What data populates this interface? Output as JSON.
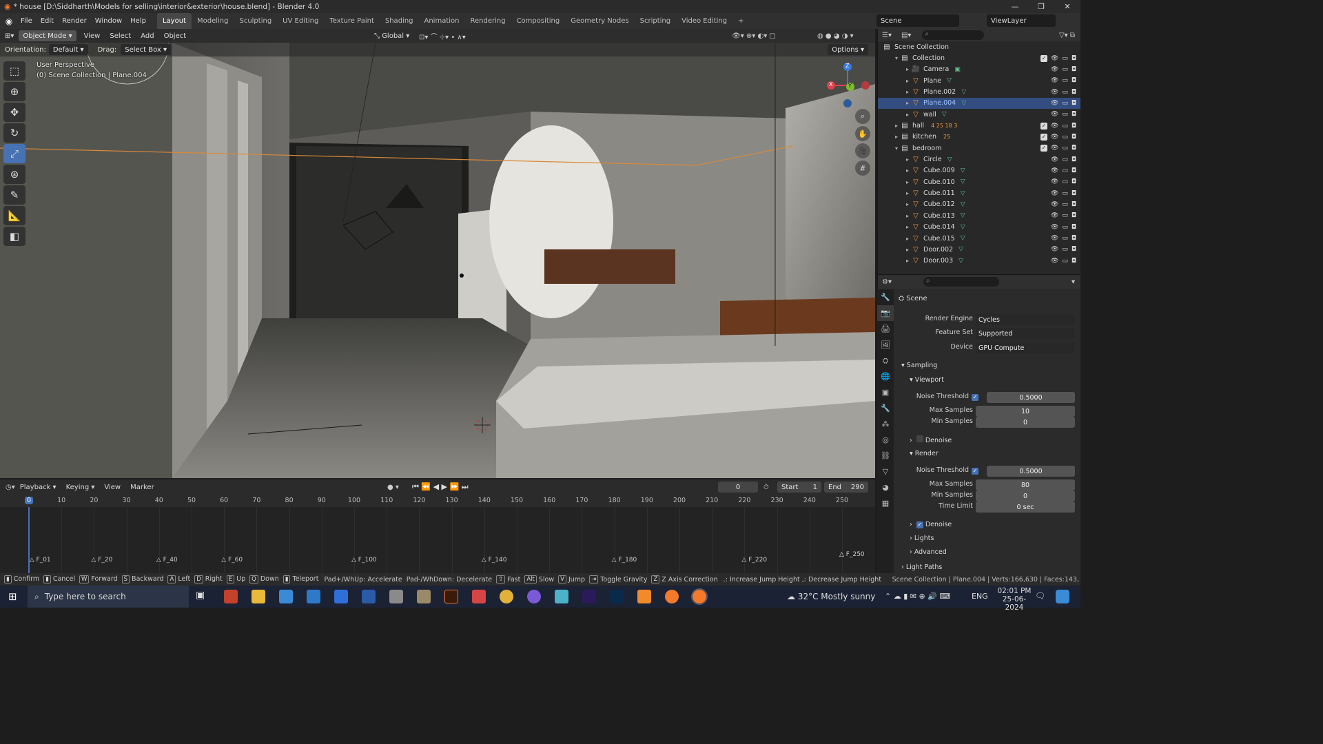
{
  "window": {
    "title": "* house [D:\\Siddharth\\Models for selling\\interior&exterior\\house.blend] - Blender 4.0"
  },
  "menu": [
    "File",
    "Edit",
    "Render",
    "Window",
    "Help"
  ],
  "workspaces": [
    "Layout",
    "Modeling",
    "Sculpting",
    "UV Editing",
    "Texture Paint",
    "Shading",
    "Animation",
    "Rendering",
    "Compositing",
    "Geometry Nodes",
    "Scripting",
    "Video Editing"
  ],
  "scene": {
    "name": "Scene",
    "view_layer": "ViewLayer"
  },
  "viewport": {
    "mode": "Object Mode",
    "menus": [
      "View",
      "Select",
      "Add",
      "Object"
    ],
    "transform_orientation": "Global",
    "orientation_label": "Orientation:",
    "orientation_value": "Default",
    "drag_label": "Drag:",
    "drag_value": "Select Box",
    "options_label": "Options",
    "perspective": "User Perspective",
    "collection_info": "(0) Scene Collection | Plane.004",
    "axis_x": "X",
    "axis_y": "Y",
    "axis_z": "Z"
  },
  "outliner": {
    "root": "Scene Collection",
    "rows": [
      {
        "name": "Collection",
        "type": "collection",
        "level": 0
      },
      {
        "name": "Camera",
        "type": "camera",
        "level": 1
      },
      {
        "name": "Plane",
        "type": "mesh",
        "level": 1
      },
      {
        "name": "Plane.002",
        "type": "mesh",
        "level": 1
      },
      {
        "name": "Plane.004",
        "type": "mesh",
        "level": 1,
        "selected": true
      },
      {
        "name": "wall",
        "type": "mesh",
        "level": 1
      },
      {
        "name": "hall",
        "type": "collection",
        "level": 0,
        "badges": "4 25 18 3"
      },
      {
        "name": "kitchen",
        "type": "collection",
        "level": 0,
        "badges": "25"
      },
      {
        "name": "bedroom",
        "type": "collection",
        "level": 0
      },
      {
        "name": "Circle",
        "type": "mesh",
        "level": 1
      },
      {
        "name": "Cube.009",
        "type": "mesh",
        "level": 1
      },
      {
        "name": "Cube.010",
        "type": "mesh",
        "level": 1
      },
      {
        "name": "Cube.011",
        "type": "mesh",
        "level": 1
      },
      {
        "name": "Cube.012",
        "type": "mesh",
        "level": 1
      },
      {
        "name": "Cube.013",
        "type": "mesh",
        "level": 1
      },
      {
        "name": "Cube.014",
        "type": "mesh",
        "level": 1
      },
      {
        "name": "Cube.015",
        "type": "mesh",
        "level": 1
      },
      {
        "name": "Door.002",
        "type": "mesh",
        "level": 1
      },
      {
        "name": "Door.003",
        "type": "mesh",
        "level": 1
      }
    ]
  },
  "properties": {
    "context": "Scene",
    "render_engine_label": "Render Engine",
    "render_engine": "Cycles",
    "feature_set_label": "Feature Set",
    "feature_set": "Supported",
    "device_label": "Device",
    "device": "GPU Compute",
    "sampling": "Sampling",
    "viewport_section": "Viewport",
    "noise_threshold_label": "Noise Threshold",
    "max_samples_label": "Max Samples",
    "min_samples_label": "Min Samples",
    "time_limit_label": "Time Limit",
    "vp_noise": "0.5000",
    "vp_max": "10",
    "vp_min": "0",
    "denoise_label": "Denoise",
    "render_section": "Render",
    "r_noise": "0.5000",
    "r_max": "80",
    "r_min": "0",
    "r_time": "0 sec",
    "lights": "Lights",
    "advanced": "Advanced",
    "light_paths": "Light Paths"
  },
  "timeline": {
    "menus": [
      "Playback",
      "Keying",
      "View",
      "Marker"
    ],
    "current_frame": "0",
    "start_label": "Start",
    "start": "1",
    "end_label": "End",
    "end": "290",
    "ticks": [
      "0",
      "10",
      "20",
      "30",
      "40",
      "50",
      "60",
      "70",
      "80",
      "90",
      "100",
      "110",
      "120",
      "130",
      "140",
      "150",
      "160",
      "170",
      "180",
      "190",
      "200",
      "210",
      "220",
      "230",
      "240",
      "250"
    ],
    "markers": [
      "F_01",
      "F_20",
      "F_40",
      "F_60",
      "F_100",
      "F_140",
      "F_180",
      "F_220",
      "F_250"
    ]
  },
  "statusbar": {
    "items": [
      {
        "key": "",
        "label": "Confirm"
      },
      {
        "key": "",
        "label": "Cancel"
      },
      {
        "key": "W",
        "label": "Forward"
      },
      {
        "key": "S",
        "label": "Backward"
      },
      {
        "key": "A",
        "label": "Left"
      },
      {
        "key": "D",
        "label": "Right"
      },
      {
        "key": "E",
        "label": "Up"
      },
      {
        "key": "Q",
        "label": "Down"
      },
      {
        "key": "",
        "label": "Teleport"
      }
    ],
    "accelerate": "Pad+/WhUp: Accelerate",
    "decelerate": "Pad-/WhDown: Decelerate",
    "fast": "Fast",
    "slow": "Slow",
    "jump": "Jump",
    "gravity": "Toggle Gravity",
    "zaxis": "Z Axis Correction",
    "jump_height": ".: Increase Jump Height ,: Decrease Jump Height",
    "stats": "Scene Collection | Plane.004 | Verts:166,630 | Faces:143,"
  },
  "taskbar": {
    "search_placeholder": "Type here to search",
    "weather": "32°C  Mostly sunny",
    "lang": "ENG",
    "time": "02:01 PM",
    "date": "25-06-2024"
  }
}
